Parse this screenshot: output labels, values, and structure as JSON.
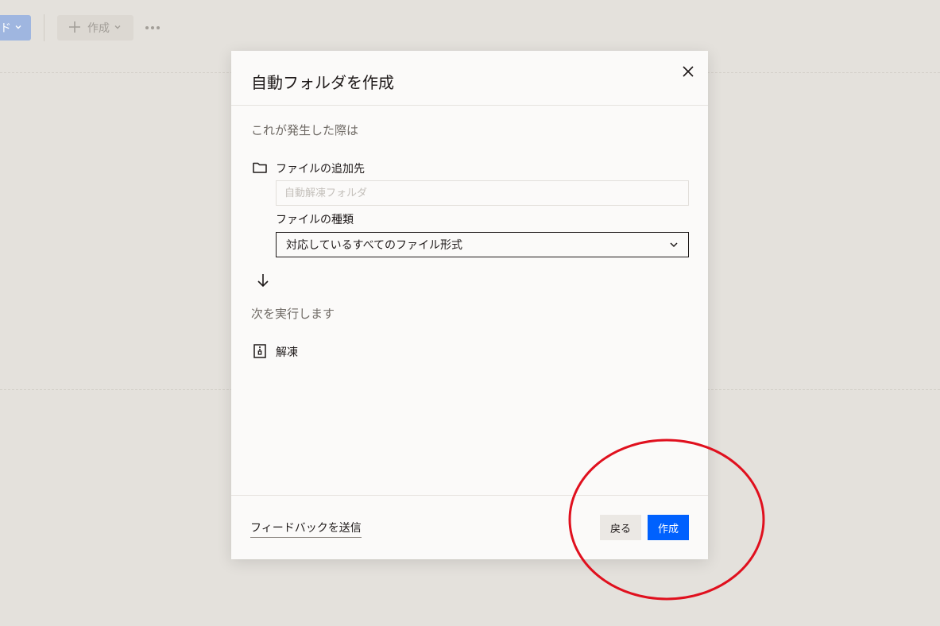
{
  "toolbar": {
    "upload_label": "ド",
    "create_label": "作成",
    "more_label": "•••"
  },
  "modal": {
    "title": "自動フォルダを作成",
    "trigger_label": "これが発生した際は",
    "destination_label": "ファイルの追加先",
    "destination_placeholder": "自動解凍フォルダ",
    "filetype_label": "ファイルの種類",
    "filetype_value": "対応しているすべてのファイル形式",
    "action_label": "次を実行します",
    "action_item": "解凍",
    "feedback_link": "フィードバックを送信",
    "back_button": "戻る",
    "create_button": "作成"
  },
  "colors": {
    "primary": "#0061fe",
    "annotation": "#e0101e",
    "backdrop": "#e4e1dc"
  }
}
